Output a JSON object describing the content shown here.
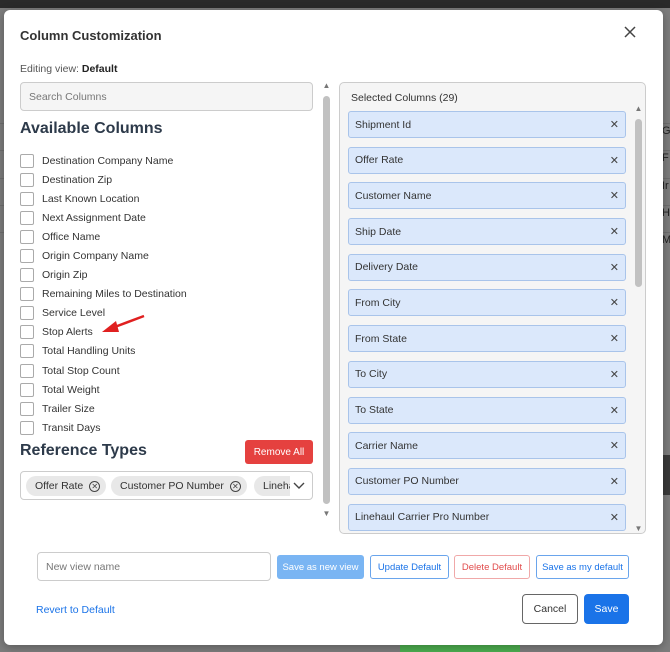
{
  "modal": {
    "title": "Column Customization",
    "editing_label": "Editing view:",
    "editing_value": "Default",
    "search_placeholder": "Search Columns",
    "available_heading": "Available Columns",
    "available_columns": [
      "Destination Company Name",
      "Destination Zip",
      "Last Known Location",
      "Next Assignment Date",
      "Office Name",
      "Origin Company Name",
      "Origin Zip",
      "Remaining Miles to Destination",
      "Service Level",
      "Stop Alerts",
      "Total Handling Units",
      "Total Stop Count",
      "Total Weight",
      "Trailer Size",
      "Transit Days"
    ],
    "reference_heading": "Reference Types",
    "remove_all_label": "Remove All",
    "reference_chips": [
      "Offer Rate",
      "Customer PO Number",
      "Linehaul Carrier Pro Number"
    ],
    "selected_heading": "Selected Columns (29)",
    "selected_columns": [
      "Shipment Id",
      "Offer Rate",
      "Customer Name",
      "Ship Date",
      "Delivery Date",
      "From City",
      "From State",
      "To City",
      "To State",
      "Carrier Name",
      "Customer PO Number",
      "Linehaul Carrier Pro Number"
    ],
    "view_name_placeholder": "New view name",
    "buttons": {
      "save_new": "Save as new view",
      "update_default": "Update Default",
      "delete_default": "Delete Default",
      "save_my_default": "Save as my default",
      "revert": "Revert to Default",
      "cancel": "Cancel",
      "save": "Save"
    }
  },
  "background": {
    "edge_letters": [
      "G",
      "F",
      "Ir",
      "H",
      "M"
    ]
  },
  "colors": {
    "primary": "#1a73e8",
    "danger": "#e5413f",
    "chip_bg": "#dbe8fb",
    "annotation_arrow": "#e02020"
  }
}
